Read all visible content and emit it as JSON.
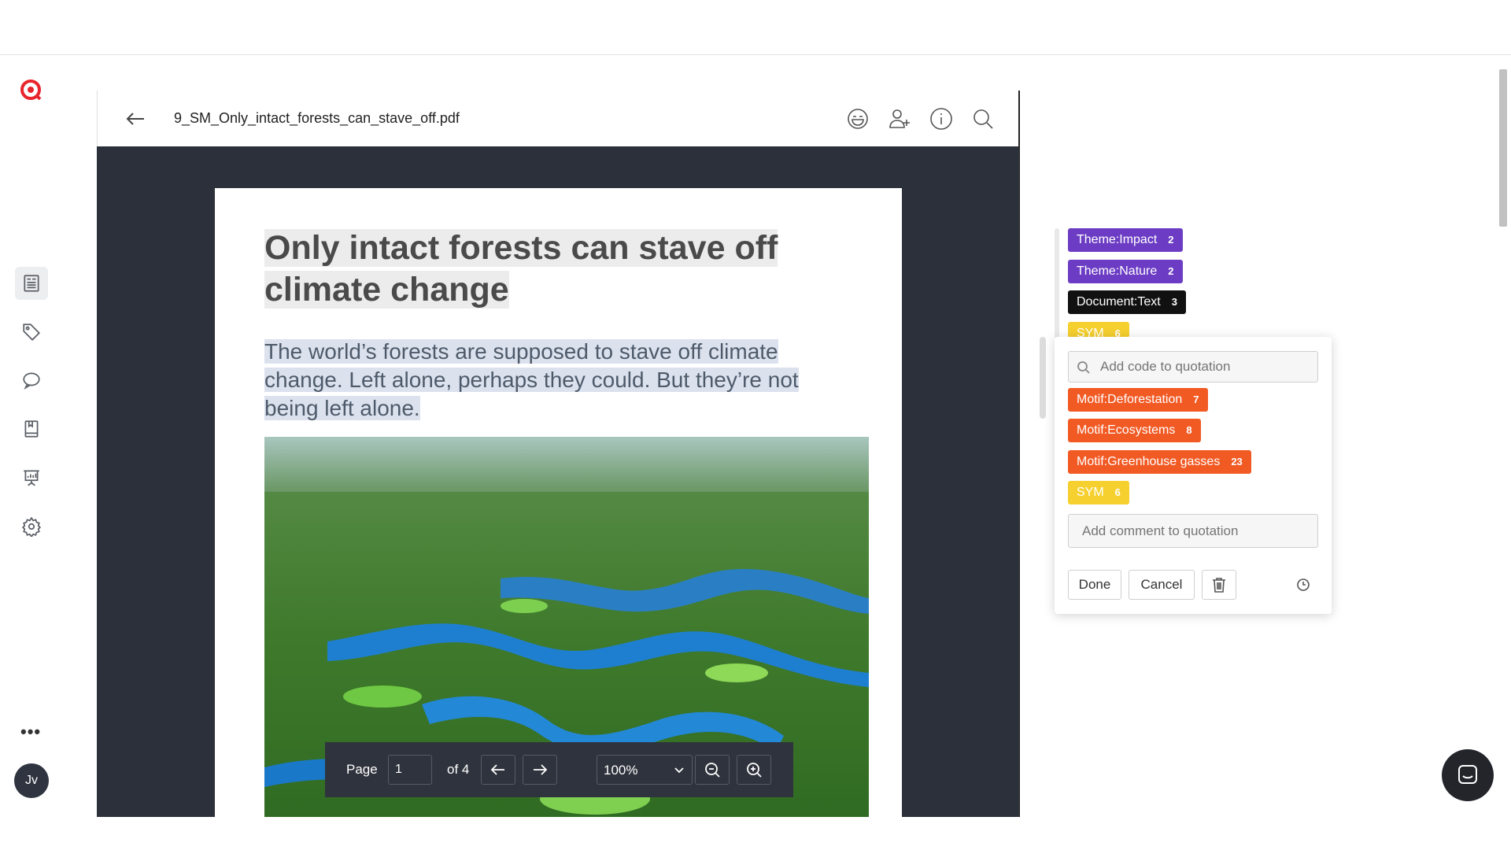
{
  "app": {
    "user_initials": "Jv",
    "more_label": "•••"
  },
  "header": {
    "document_name": "9_SM_Only_intact_forests_can_stave_off.pdf"
  },
  "document": {
    "title": "Only intact forests can stave off climate change",
    "subtitle": "The world’s forests are supposed to stave off climate change. Left alone, perhaps they could. But they’re not being left alone."
  },
  "pager": {
    "page_label": "Page",
    "page_value": "1",
    "of_label": "of 4",
    "zoom_value": "100%"
  },
  "codes": [
    {
      "name": "Theme:Impact",
      "count": "2",
      "color": "#6c3dc4"
    },
    {
      "name": "Theme:Nature",
      "count": "2",
      "color": "#6c3dc4"
    },
    {
      "name": "Document:Text",
      "count": "3",
      "color": "#111111"
    },
    {
      "name": "SYM",
      "count": "6",
      "color": "#f6d02f"
    }
  ],
  "popup": {
    "search_placeholder": "Add code to quotation",
    "codes": [
      {
        "name": "Motif:Deforestation",
        "count": "7",
        "color": "#f25a24"
      },
      {
        "name": "Motif:Ecosystems",
        "count": "8",
        "color": "#f25a24"
      },
      {
        "name": "Motif:Greenhouse gasses",
        "count": "23",
        "color": "#f25a24"
      },
      {
        "name": "SYM",
        "count": "6",
        "color": "#f6d02f"
      }
    ],
    "comment_placeholder": "Add comment to quotation",
    "done_label": "Done",
    "cancel_label": "Cancel"
  },
  "icons": [
    "logo-icon",
    "documents-icon",
    "codes-icon",
    "comments-icon",
    "memos-icon",
    "presentation-icon",
    "settings-icon",
    "back-arrow-icon",
    "emoji-icon",
    "add-user-icon",
    "info-icon",
    "search-icon",
    "prev-page-icon",
    "next-page-icon",
    "zoom-out-icon",
    "zoom-in-icon",
    "chevron-down-icon",
    "trash-icon",
    "clock-icon",
    "chat-icon"
  ]
}
